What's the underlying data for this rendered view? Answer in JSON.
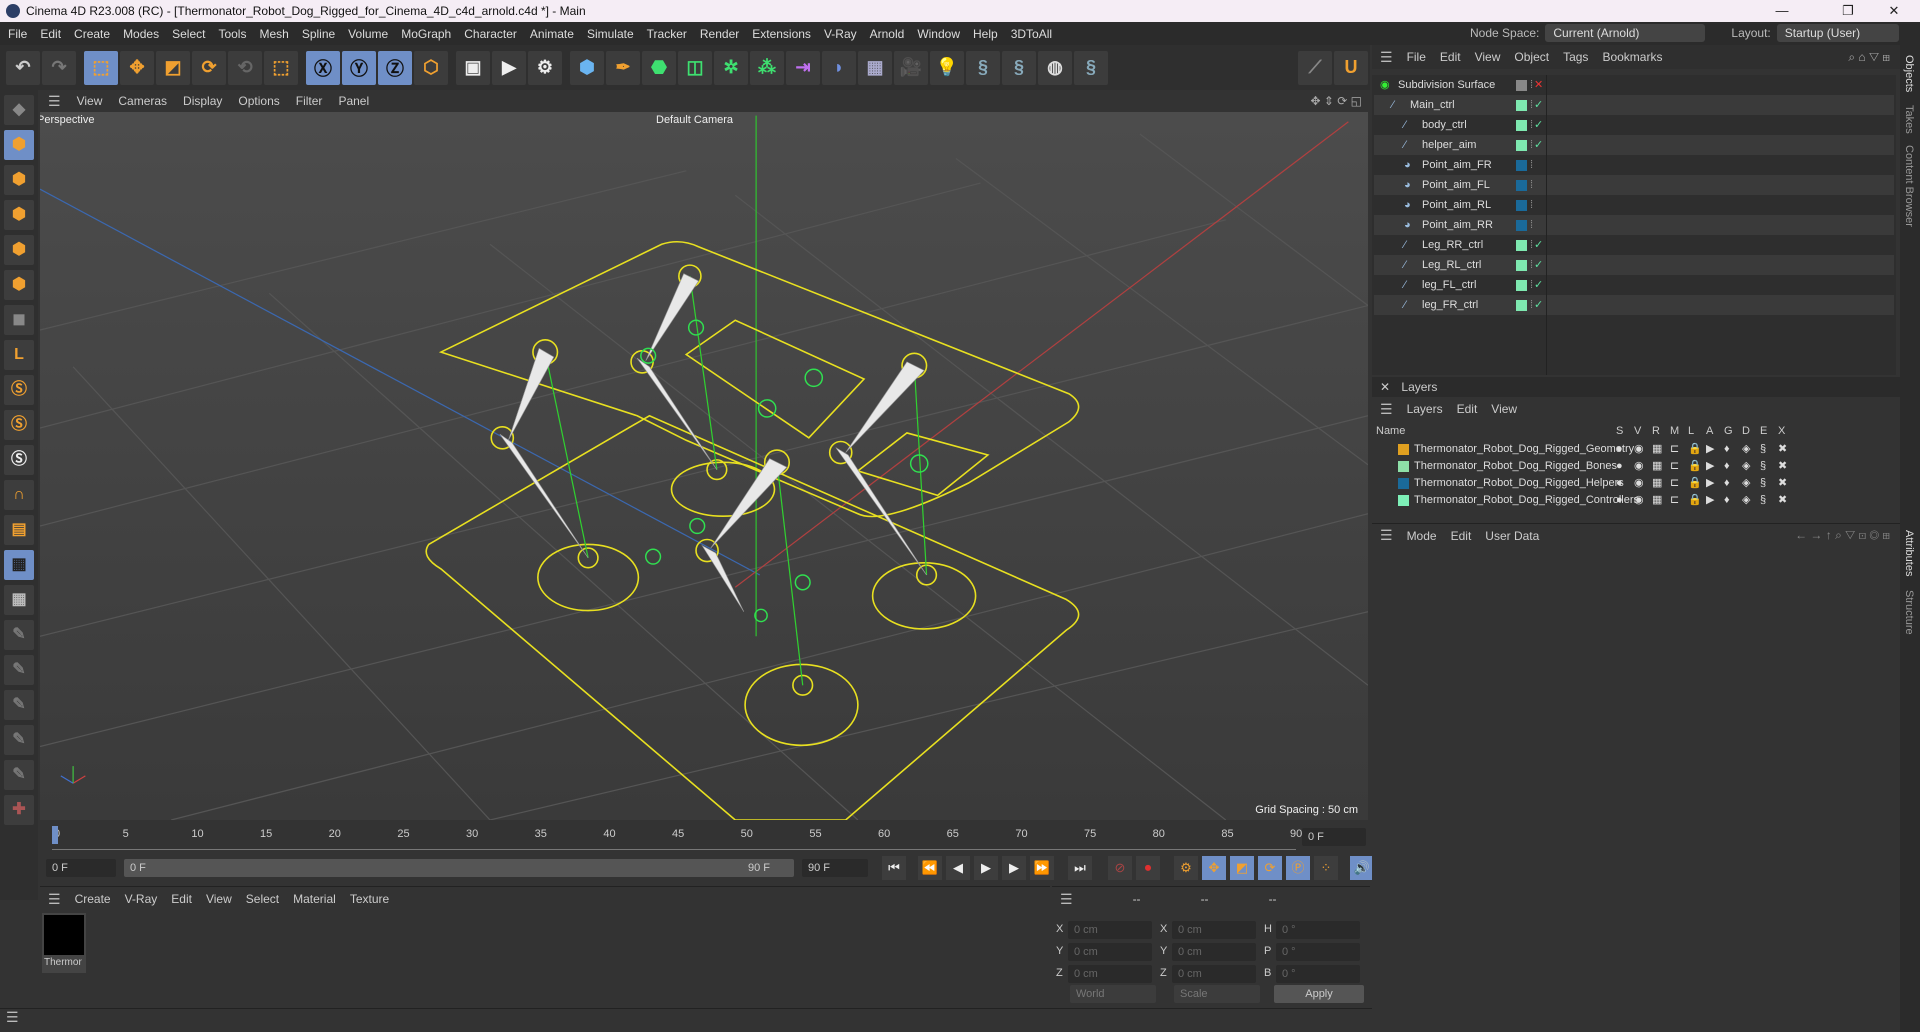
{
  "window": {
    "title": "Cinema 4D R23.008 (RC) - [Thermonator_Robot_Dog_Rigged_for_Cinema_4D_c4d_arnold.c4d *] - Main",
    "minimize": "—",
    "maximize": "❐",
    "close": "✕"
  },
  "menu": [
    "File",
    "Edit",
    "Create",
    "Modes",
    "Select",
    "Tools",
    "Mesh",
    "Spline",
    "Volume",
    "MoGraph",
    "Character",
    "Animate",
    "Simulate",
    "Tracker",
    "Render",
    "Extensions",
    "V-Ray",
    "Arnold",
    "Window",
    "Help",
    "3DToAll"
  ],
  "header": {
    "node_space_label": "Node Space:",
    "node_space_value": "Current (Arnold)",
    "layout_label": "Layout:",
    "layout_value": "Startup (User)"
  },
  "viewport": {
    "menu": [
      "View",
      "Cameras",
      "Display",
      "Options",
      "Filter",
      "Panel"
    ],
    "projection": "Perspective",
    "camera": "Default Camera",
    "grid_spacing": "Grid Spacing : 50 cm"
  },
  "objects": {
    "menu": [
      "File",
      "Edit",
      "View",
      "Object",
      "Tags",
      "Bookmarks"
    ],
    "items": [
      {
        "name": "Subdivision Surface",
        "color": "#888888"
      },
      {
        "name": "Main_ctrl",
        "color": "#7ee8b0"
      },
      {
        "name": "body_ctrl",
        "color": "#7ee8b0"
      },
      {
        "name": "helper_aim",
        "color": "#7ee8b0"
      },
      {
        "name": "Point_aim_FR",
        "color": "#1a6a9a"
      },
      {
        "name": "Point_aim_FL",
        "color": "#1a6a9a"
      },
      {
        "name": "Point_aim_RL",
        "color": "#1a6a9a"
      },
      {
        "name": "Point_aim_RR",
        "color": "#1a6a9a"
      },
      {
        "name": "Leg_RR_ctrl",
        "color": "#7ee8b0"
      },
      {
        "name": "Leg_RL_ctrl",
        "color": "#7ee8b0"
      },
      {
        "name": "leg_FL_ctrl",
        "color": "#7ee8b0"
      },
      {
        "name": "leg_FR_ctrl",
        "color": "#7ee8b0"
      }
    ]
  },
  "side_tabs": [
    "Objects",
    "Takes",
    "Content Browser",
    "Attributes",
    "Structure"
  ],
  "layers": {
    "title": "Layers",
    "menu": [
      "Layers",
      "Edit",
      "View"
    ],
    "columns": [
      "Name",
      "S",
      "V",
      "R",
      "M",
      "L",
      "A",
      "G",
      "D",
      "E",
      "X"
    ],
    "items": [
      {
        "name": "Thermonator_Robot_Dog_Rigged_Geometry",
        "color": "#e0a020"
      },
      {
        "name": "Thermonator_Robot_Dog_Rigged_Bones",
        "color": "#8ee0a8"
      },
      {
        "name": "Thermonator_Robot_Dog_Rigged_Helpers",
        "color": "#1a6a9a"
      },
      {
        "name": "Thermonator_Robot_Dog_Rigged_Controllers",
        "color": "#7ef0b8"
      }
    ]
  },
  "attributes": {
    "menu": [
      "Mode",
      "Edit",
      "User Data"
    ]
  },
  "timeline": {
    "ticks": [
      "0",
      "5",
      "10",
      "15",
      "20",
      "25",
      "30",
      "35",
      "40",
      "45",
      "50",
      "55",
      "60",
      "65",
      "70",
      "75",
      "80",
      "85",
      "90"
    ],
    "current_frame": "0 F",
    "start": "0 F",
    "range_start": "0 F",
    "range_end": "90 F",
    "end": "90 F"
  },
  "materials": {
    "menu": [
      "Create",
      "V-Ray",
      "Edit",
      "View",
      "Select",
      "Material",
      "Texture"
    ],
    "items": [
      {
        "name": "Thermor"
      }
    ]
  },
  "coords": {
    "headers": [
      "--",
      "--",
      "--"
    ],
    "rows": [
      {
        "l1": "X",
        "v1": "0 cm",
        "l2": "X",
        "v2": "0 cm",
        "l3": "H",
        "v3": "0 °"
      },
      {
        "l1": "Y",
        "v1": "0 cm",
        "l2": "Y",
        "v2": "0 cm",
        "l3": "P",
        "v3": "0 °"
      },
      {
        "l1": "Z",
        "v1": "0 cm",
        "l2": "Z",
        "v2": "0 cm",
        "l3": "B",
        "v3": "0 °"
      }
    ],
    "space": "World",
    "mode": "Scale",
    "apply": "Apply"
  }
}
